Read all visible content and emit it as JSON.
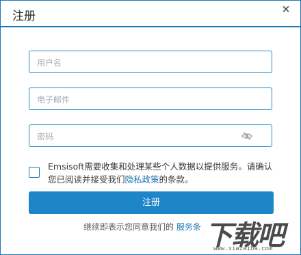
{
  "dialog": {
    "title": "注册",
    "close_symbol": "×"
  },
  "form": {
    "username_placeholder": "用户名",
    "email_placeholder": "电子邮件",
    "password_placeholder": "密码",
    "password_toggle_icon": "eye-slash-icon"
  },
  "consent": {
    "text_before": "Emsisoft需要收集和处理某些个人数据以提供服务。请确认您已阅读并接受我们",
    "privacy_link": "隐私政策",
    "text_after": "的条款。",
    "checked": false
  },
  "actions": {
    "register_label": "注册"
  },
  "footer": {
    "text": "继续即表示您同意我们的",
    "terms_link": "服务条"
  },
  "watermark": {
    "big_text": "下载吧",
    "small_text": "www.xiazaiba.com"
  },
  "colors": {
    "accent": "#1e85c8",
    "border": "#1b77b5",
    "placeholder": "#a6acb3"
  }
}
